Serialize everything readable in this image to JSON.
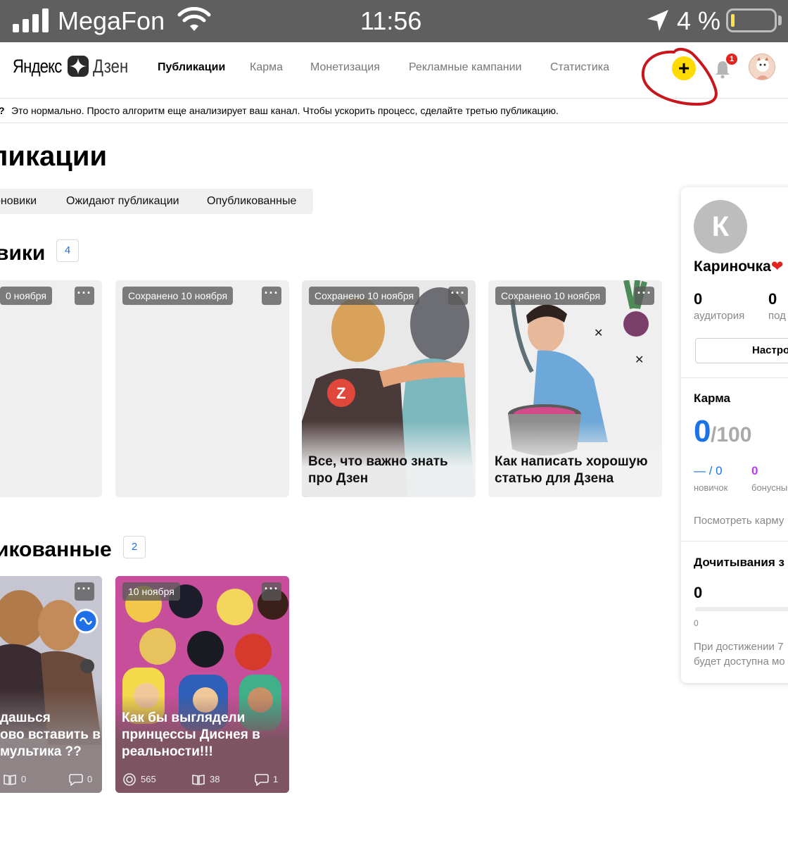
{
  "status_bar": {
    "carrier": "MegaFon",
    "time": "11:56",
    "battery": "4 %"
  },
  "header": {
    "logo_brand": "Яндекс",
    "logo_product": "Дзен",
    "nav": [
      "Публикации",
      "Карма",
      "Монетизация",
      "Рекламные кампании",
      "Статистика"
    ],
    "add_label": "+",
    "notification_count": "1"
  },
  "notice": {
    "mark": "?",
    "text": "Это нормально. Просто алгоритм еще анализирует ваш канал. Чтобы ускорить процесс, сделайте третью публикацию."
  },
  "page_title": "ликации",
  "tabs": [
    "рновики",
    "Ожидают публикации",
    "Опубликованные"
  ],
  "drafts": {
    "title": "вики",
    "count": "4",
    "cards": [
      {
        "tag": "0 ноября",
        "more": "···",
        "title": ""
      },
      {
        "tag": "Сохранено 10 ноября",
        "more": "···",
        "title": ""
      },
      {
        "tag": "Сохранено 10 ноября",
        "more": "···",
        "title": "Все, что важно знать про Дзен"
      },
      {
        "tag": "Сохранено 10 ноября",
        "more": "···",
        "title": "Как написать хорошую статью для Дзена"
      }
    ]
  },
  "published": {
    "title": "икованные",
    "count": "2",
    "cards": [
      {
        "more": "···",
        "title": "дашься\nово вставить в\nмультика ??",
        "reads": "0",
        "comments": "0"
      },
      {
        "tag": "10 ноября",
        "more": "···",
        "title": "Как бы выглядели принцессы Диснея в реальности!!!",
        "views": "565",
        "reads": "38",
        "comments": "1"
      }
    ]
  },
  "sidebar": {
    "avatar_letter": "К",
    "name": "Кариночка",
    "audience_value": "0",
    "audience_label": "аудитория",
    "subs_value": "0",
    "subs_label": "под",
    "settings_button": "Настро",
    "karma_title": "Карма",
    "karma_value": "0",
    "karma_max": "/100",
    "novice_value": "— / 0",
    "novice_label": "новичок",
    "bonus_value": "0",
    "bonus_label": "бонусны",
    "karma_link": "Посмотреть карму",
    "reads_title": "Дочитывания з",
    "reads_value": "0",
    "reads_axis": "0",
    "reads_note_1": "При достижении 7",
    "reads_note_2": "будет доступна мо"
  },
  "colors": {
    "accent_yellow": "#ffdb00",
    "link_blue": "#1a73e8",
    "annotation_red": "#c8161d",
    "bonus_purple": "#b83cf5"
  }
}
